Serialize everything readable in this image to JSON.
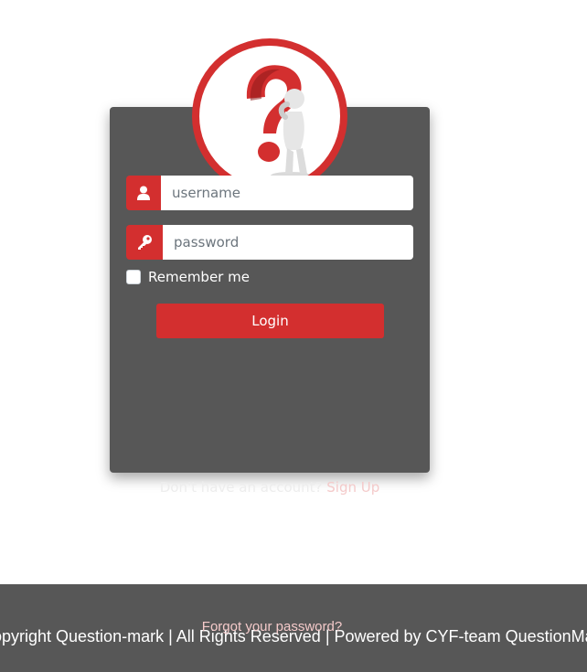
{
  "login": {
    "username_placeholder": "username",
    "password_placeholder": "password",
    "remember_label": "Remember me",
    "login_label": "Login"
  },
  "signup": {
    "prompt": "Don't have an account?",
    "link": "Sign Up"
  },
  "footer": {
    "forgot": "Forgot your password?",
    "copyright": "opyright Question-mark | All Rights Reserved | Powered by CYF-team QuestionMark"
  },
  "colors": {
    "accent": "#d32f2f",
    "card": "#575757",
    "footer": "#575757"
  },
  "icons": {
    "logo": "question-mark-figure",
    "username": "user-icon",
    "password": "key-icon"
  }
}
